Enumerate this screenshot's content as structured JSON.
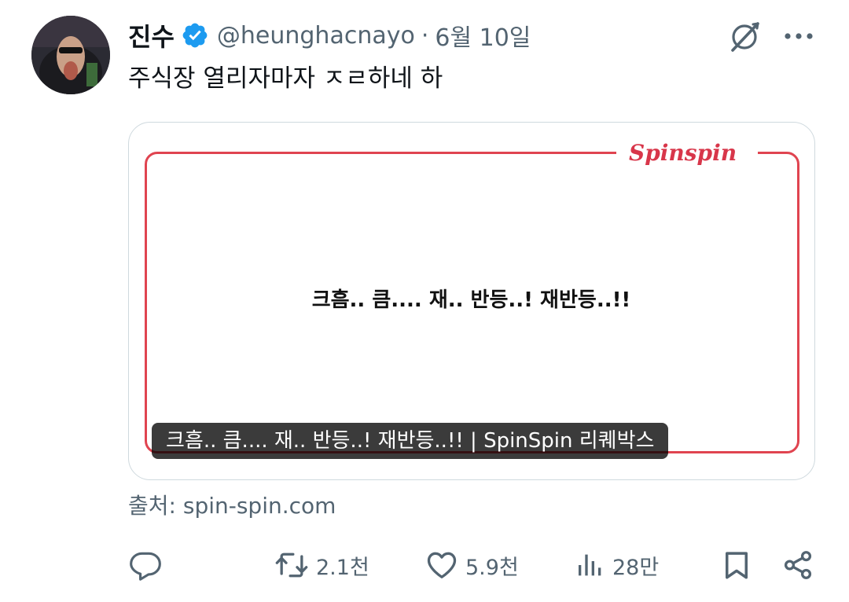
{
  "tweet": {
    "author": {
      "display_name": "진수",
      "handle": "@heunghacnayo",
      "verified": true,
      "avatar_icon": "avatar-photo"
    },
    "separator": "·",
    "date": "6월 10일",
    "text": "주식장 열리자마자 ㅈㄹ하네 하",
    "card": {
      "logo_text": "Spinspin",
      "body_text": "크흠.. 큼....  재.. 반등..! 재반등..!!",
      "title": "크흠.. 큼.... 재.. 반등..! 재반등..!! | SpinSpin 리퀘박스"
    },
    "source": "출처: spin-spin.com",
    "actions": {
      "reply": {
        "icon": "reply-icon",
        "count": ""
      },
      "retweet": {
        "icon": "retweet-icon",
        "count": "2.1천"
      },
      "like": {
        "icon": "heart-icon",
        "count": "5.9천"
      },
      "views": {
        "icon": "analytics-icon",
        "count": "28만"
      },
      "bookmark": {
        "icon": "bookmark-icon"
      },
      "share": {
        "icon": "share-icon"
      }
    }
  },
  "colors": {
    "text_primary": "#0f1419",
    "text_secondary": "#536471",
    "verified_blue": "#1d9bf0",
    "card_border": "#cfd9de",
    "card_frame_red": "#e04450",
    "title_pill_bg": "rgba(0,0,0,0.77)"
  }
}
